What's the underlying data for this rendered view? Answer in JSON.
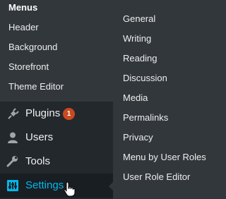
{
  "appearance_submenu": {
    "items": [
      {
        "label": "Menus",
        "current": true
      },
      {
        "label": "Header"
      },
      {
        "label": "Background"
      },
      {
        "label": "Storefront"
      },
      {
        "label": "Theme Editor"
      }
    ]
  },
  "main_menu": {
    "plugins": {
      "label": "Plugins",
      "icon": "plugin-icon",
      "badge": "1"
    },
    "users": {
      "label": "Users",
      "icon": "user-icon"
    },
    "tools": {
      "label": "Tools",
      "icon": "wrench-icon"
    },
    "settings": {
      "label": "Settings",
      "icon": "settings-sliders-icon",
      "active": true
    }
  },
  "settings_flyout": {
    "items": [
      {
        "label": "General"
      },
      {
        "label": "Writing"
      },
      {
        "label": "Reading"
      },
      {
        "label": "Discussion"
      },
      {
        "label": "Media"
      },
      {
        "label": "Permalinks"
      },
      {
        "label": "Privacy"
      },
      {
        "label": "Menu by User Roles"
      },
      {
        "label": "User Role Editor"
      }
    ]
  },
  "colors": {
    "menu_bg": "#23282d",
    "submenu_bg": "#32373c",
    "active_bg": "#191e23",
    "accent": "#00b9eb",
    "badge_bg": "#ca4a1f"
  }
}
